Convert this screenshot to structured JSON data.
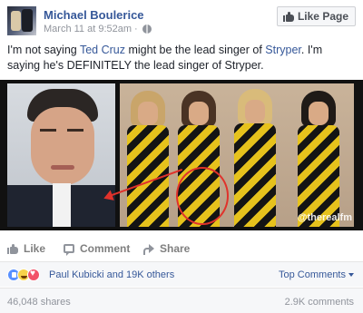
{
  "header": {
    "author": "Michael Boulerice",
    "timestamp": "March 11 at 9:52am",
    "separator": "·",
    "like_page_label": "Like Page"
  },
  "post": {
    "text_part1": "I'm not saying ",
    "link1": "Ted Cruz",
    "text_part2": " might be the lead singer of ",
    "link2": "Stryper",
    "text_part3": ". I'm saying he's DEFINITELY the lead singer of Stryper.",
    "image_watermark": "@therealfm"
  },
  "actions": {
    "like": "Like",
    "comment": "Comment",
    "share": "Share"
  },
  "reactions": {
    "icons": [
      "like-reaction-icon",
      "haha-reaction-icon",
      "love-reaction-icon"
    ],
    "summary": "Paul Kubicki and 19K others",
    "sort_label": "Top Comments"
  },
  "stats": {
    "shares": "46,048 shares",
    "comments": "2.9K comments"
  },
  "colors": {
    "link": "#365899",
    "muted": "#90949c",
    "annotation_red": "#e0322b"
  }
}
